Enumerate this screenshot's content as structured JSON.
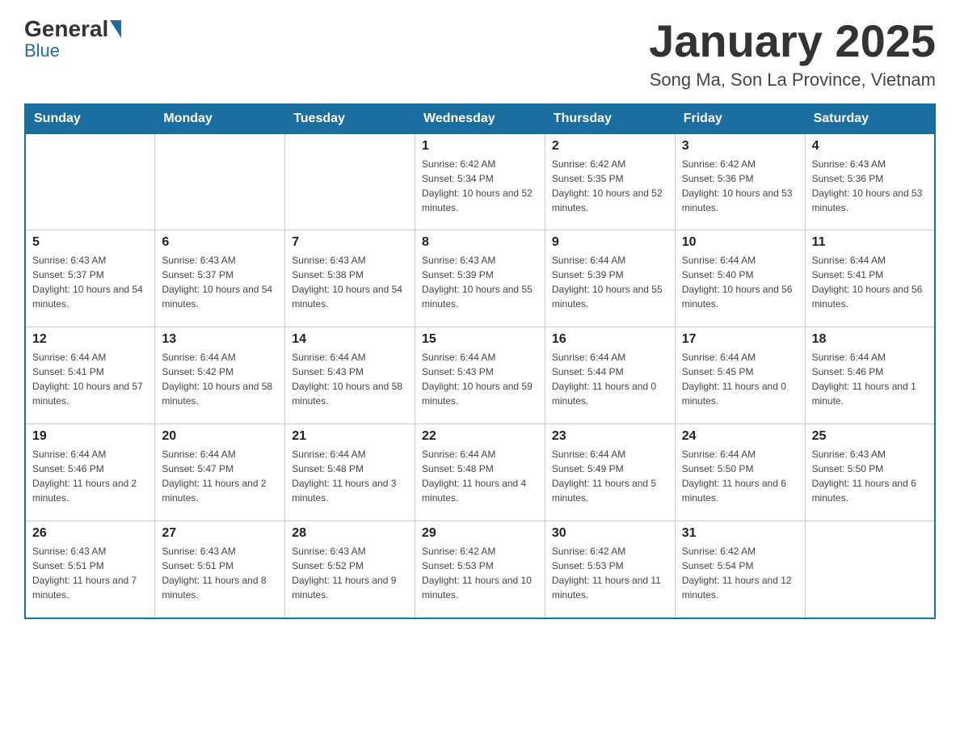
{
  "header": {
    "title": "January 2025",
    "location": "Song Ma, Son La Province, Vietnam",
    "logo_general": "General",
    "logo_blue": "Blue"
  },
  "days_of_week": [
    "Sunday",
    "Monday",
    "Tuesday",
    "Wednesday",
    "Thursday",
    "Friday",
    "Saturday"
  ],
  "weeks": [
    [
      {
        "day": "",
        "sunrise": "",
        "sunset": "",
        "daylight": ""
      },
      {
        "day": "",
        "sunrise": "",
        "sunset": "",
        "daylight": ""
      },
      {
        "day": "",
        "sunrise": "",
        "sunset": "",
        "daylight": ""
      },
      {
        "day": "1",
        "sunrise": "Sunrise: 6:42 AM",
        "sunset": "Sunset: 5:34 PM",
        "daylight": "Daylight: 10 hours and 52 minutes."
      },
      {
        "day": "2",
        "sunrise": "Sunrise: 6:42 AM",
        "sunset": "Sunset: 5:35 PM",
        "daylight": "Daylight: 10 hours and 52 minutes."
      },
      {
        "day": "3",
        "sunrise": "Sunrise: 6:42 AM",
        "sunset": "Sunset: 5:36 PM",
        "daylight": "Daylight: 10 hours and 53 minutes."
      },
      {
        "day": "4",
        "sunrise": "Sunrise: 6:43 AM",
        "sunset": "Sunset: 5:36 PM",
        "daylight": "Daylight: 10 hours and 53 minutes."
      }
    ],
    [
      {
        "day": "5",
        "sunrise": "Sunrise: 6:43 AM",
        "sunset": "Sunset: 5:37 PM",
        "daylight": "Daylight: 10 hours and 54 minutes."
      },
      {
        "day": "6",
        "sunrise": "Sunrise: 6:43 AM",
        "sunset": "Sunset: 5:37 PM",
        "daylight": "Daylight: 10 hours and 54 minutes."
      },
      {
        "day": "7",
        "sunrise": "Sunrise: 6:43 AM",
        "sunset": "Sunset: 5:38 PM",
        "daylight": "Daylight: 10 hours and 54 minutes."
      },
      {
        "day": "8",
        "sunrise": "Sunrise: 6:43 AM",
        "sunset": "Sunset: 5:39 PM",
        "daylight": "Daylight: 10 hours and 55 minutes."
      },
      {
        "day": "9",
        "sunrise": "Sunrise: 6:44 AM",
        "sunset": "Sunset: 5:39 PM",
        "daylight": "Daylight: 10 hours and 55 minutes."
      },
      {
        "day": "10",
        "sunrise": "Sunrise: 6:44 AM",
        "sunset": "Sunset: 5:40 PM",
        "daylight": "Daylight: 10 hours and 56 minutes."
      },
      {
        "day": "11",
        "sunrise": "Sunrise: 6:44 AM",
        "sunset": "Sunset: 5:41 PM",
        "daylight": "Daylight: 10 hours and 56 minutes."
      }
    ],
    [
      {
        "day": "12",
        "sunrise": "Sunrise: 6:44 AM",
        "sunset": "Sunset: 5:41 PM",
        "daylight": "Daylight: 10 hours and 57 minutes."
      },
      {
        "day": "13",
        "sunrise": "Sunrise: 6:44 AM",
        "sunset": "Sunset: 5:42 PM",
        "daylight": "Daylight: 10 hours and 58 minutes."
      },
      {
        "day": "14",
        "sunrise": "Sunrise: 6:44 AM",
        "sunset": "Sunset: 5:43 PM",
        "daylight": "Daylight: 10 hours and 58 minutes."
      },
      {
        "day": "15",
        "sunrise": "Sunrise: 6:44 AM",
        "sunset": "Sunset: 5:43 PM",
        "daylight": "Daylight: 10 hours and 59 minutes."
      },
      {
        "day": "16",
        "sunrise": "Sunrise: 6:44 AM",
        "sunset": "Sunset: 5:44 PM",
        "daylight": "Daylight: 11 hours and 0 minutes."
      },
      {
        "day": "17",
        "sunrise": "Sunrise: 6:44 AM",
        "sunset": "Sunset: 5:45 PM",
        "daylight": "Daylight: 11 hours and 0 minutes."
      },
      {
        "day": "18",
        "sunrise": "Sunrise: 6:44 AM",
        "sunset": "Sunset: 5:46 PM",
        "daylight": "Daylight: 11 hours and 1 minute."
      }
    ],
    [
      {
        "day": "19",
        "sunrise": "Sunrise: 6:44 AM",
        "sunset": "Sunset: 5:46 PM",
        "daylight": "Daylight: 11 hours and 2 minutes."
      },
      {
        "day": "20",
        "sunrise": "Sunrise: 6:44 AM",
        "sunset": "Sunset: 5:47 PM",
        "daylight": "Daylight: 11 hours and 2 minutes."
      },
      {
        "day": "21",
        "sunrise": "Sunrise: 6:44 AM",
        "sunset": "Sunset: 5:48 PM",
        "daylight": "Daylight: 11 hours and 3 minutes."
      },
      {
        "day": "22",
        "sunrise": "Sunrise: 6:44 AM",
        "sunset": "Sunset: 5:48 PM",
        "daylight": "Daylight: 11 hours and 4 minutes."
      },
      {
        "day": "23",
        "sunrise": "Sunrise: 6:44 AM",
        "sunset": "Sunset: 5:49 PM",
        "daylight": "Daylight: 11 hours and 5 minutes."
      },
      {
        "day": "24",
        "sunrise": "Sunrise: 6:44 AM",
        "sunset": "Sunset: 5:50 PM",
        "daylight": "Daylight: 11 hours and 6 minutes."
      },
      {
        "day": "25",
        "sunrise": "Sunrise: 6:43 AM",
        "sunset": "Sunset: 5:50 PM",
        "daylight": "Daylight: 11 hours and 6 minutes."
      }
    ],
    [
      {
        "day": "26",
        "sunrise": "Sunrise: 6:43 AM",
        "sunset": "Sunset: 5:51 PM",
        "daylight": "Daylight: 11 hours and 7 minutes."
      },
      {
        "day": "27",
        "sunrise": "Sunrise: 6:43 AM",
        "sunset": "Sunset: 5:51 PM",
        "daylight": "Daylight: 11 hours and 8 minutes."
      },
      {
        "day": "28",
        "sunrise": "Sunrise: 6:43 AM",
        "sunset": "Sunset: 5:52 PM",
        "daylight": "Daylight: 11 hours and 9 minutes."
      },
      {
        "day": "29",
        "sunrise": "Sunrise: 6:42 AM",
        "sunset": "Sunset: 5:53 PM",
        "daylight": "Daylight: 11 hours and 10 minutes."
      },
      {
        "day": "30",
        "sunrise": "Sunrise: 6:42 AM",
        "sunset": "Sunset: 5:53 PM",
        "daylight": "Daylight: 11 hours and 11 minutes."
      },
      {
        "day": "31",
        "sunrise": "Sunrise: 6:42 AM",
        "sunset": "Sunset: 5:54 PM",
        "daylight": "Daylight: 11 hours and 12 minutes."
      },
      {
        "day": "",
        "sunrise": "",
        "sunset": "",
        "daylight": ""
      }
    ]
  ]
}
